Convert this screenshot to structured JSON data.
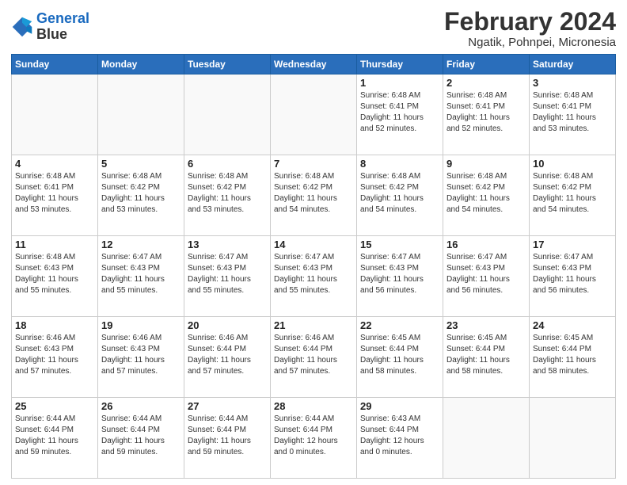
{
  "header": {
    "logo_line1": "General",
    "logo_line2": "Blue",
    "title": "February 2024",
    "subtitle": "Ngatik, Pohnpei, Micronesia"
  },
  "days_of_week": [
    "Sunday",
    "Monday",
    "Tuesday",
    "Wednesday",
    "Thursday",
    "Friday",
    "Saturday"
  ],
  "weeks": [
    [
      {
        "day": "",
        "info": ""
      },
      {
        "day": "",
        "info": ""
      },
      {
        "day": "",
        "info": ""
      },
      {
        "day": "",
        "info": ""
      },
      {
        "day": "1",
        "info": "Sunrise: 6:48 AM\nSunset: 6:41 PM\nDaylight: 11 hours\nand 52 minutes."
      },
      {
        "day": "2",
        "info": "Sunrise: 6:48 AM\nSunset: 6:41 PM\nDaylight: 11 hours\nand 52 minutes."
      },
      {
        "day": "3",
        "info": "Sunrise: 6:48 AM\nSunset: 6:41 PM\nDaylight: 11 hours\nand 53 minutes."
      }
    ],
    [
      {
        "day": "4",
        "info": "Sunrise: 6:48 AM\nSunset: 6:41 PM\nDaylight: 11 hours\nand 53 minutes."
      },
      {
        "day": "5",
        "info": "Sunrise: 6:48 AM\nSunset: 6:42 PM\nDaylight: 11 hours\nand 53 minutes."
      },
      {
        "day": "6",
        "info": "Sunrise: 6:48 AM\nSunset: 6:42 PM\nDaylight: 11 hours\nand 53 minutes."
      },
      {
        "day": "7",
        "info": "Sunrise: 6:48 AM\nSunset: 6:42 PM\nDaylight: 11 hours\nand 54 minutes."
      },
      {
        "day": "8",
        "info": "Sunrise: 6:48 AM\nSunset: 6:42 PM\nDaylight: 11 hours\nand 54 minutes."
      },
      {
        "day": "9",
        "info": "Sunrise: 6:48 AM\nSunset: 6:42 PM\nDaylight: 11 hours\nand 54 minutes."
      },
      {
        "day": "10",
        "info": "Sunrise: 6:48 AM\nSunset: 6:42 PM\nDaylight: 11 hours\nand 54 minutes."
      }
    ],
    [
      {
        "day": "11",
        "info": "Sunrise: 6:48 AM\nSunset: 6:43 PM\nDaylight: 11 hours\nand 55 minutes."
      },
      {
        "day": "12",
        "info": "Sunrise: 6:47 AM\nSunset: 6:43 PM\nDaylight: 11 hours\nand 55 minutes."
      },
      {
        "day": "13",
        "info": "Sunrise: 6:47 AM\nSunset: 6:43 PM\nDaylight: 11 hours\nand 55 minutes."
      },
      {
        "day": "14",
        "info": "Sunrise: 6:47 AM\nSunset: 6:43 PM\nDaylight: 11 hours\nand 55 minutes."
      },
      {
        "day": "15",
        "info": "Sunrise: 6:47 AM\nSunset: 6:43 PM\nDaylight: 11 hours\nand 56 minutes."
      },
      {
        "day": "16",
        "info": "Sunrise: 6:47 AM\nSunset: 6:43 PM\nDaylight: 11 hours\nand 56 minutes."
      },
      {
        "day": "17",
        "info": "Sunrise: 6:47 AM\nSunset: 6:43 PM\nDaylight: 11 hours\nand 56 minutes."
      }
    ],
    [
      {
        "day": "18",
        "info": "Sunrise: 6:46 AM\nSunset: 6:43 PM\nDaylight: 11 hours\nand 57 minutes."
      },
      {
        "day": "19",
        "info": "Sunrise: 6:46 AM\nSunset: 6:43 PM\nDaylight: 11 hours\nand 57 minutes."
      },
      {
        "day": "20",
        "info": "Sunrise: 6:46 AM\nSunset: 6:44 PM\nDaylight: 11 hours\nand 57 minutes."
      },
      {
        "day": "21",
        "info": "Sunrise: 6:46 AM\nSunset: 6:44 PM\nDaylight: 11 hours\nand 57 minutes."
      },
      {
        "day": "22",
        "info": "Sunrise: 6:45 AM\nSunset: 6:44 PM\nDaylight: 11 hours\nand 58 minutes."
      },
      {
        "day": "23",
        "info": "Sunrise: 6:45 AM\nSunset: 6:44 PM\nDaylight: 11 hours\nand 58 minutes."
      },
      {
        "day": "24",
        "info": "Sunrise: 6:45 AM\nSunset: 6:44 PM\nDaylight: 11 hours\nand 58 minutes."
      }
    ],
    [
      {
        "day": "25",
        "info": "Sunrise: 6:44 AM\nSunset: 6:44 PM\nDaylight: 11 hours\nand 59 minutes."
      },
      {
        "day": "26",
        "info": "Sunrise: 6:44 AM\nSunset: 6:44 PM\nDaylight: 11 hours\nand 59 minutes."
      },
      {
        "day": "27",
        "info": "Sunrise: 6:44 AM\nSunset: 6:44 PM\nDaylight: 11 hours\nand 59 minutes."
      },
      {
        "day": "28",
        "info": "Sunrise: 6:44 AM\nSunset: 6:44 PM\nDaylight: 12 hours\nand 0 minutes."
      },
      {
        "day": "29",
        "info": "Sunrise: 6:43 AM\nSunset: 6:44 PM\nDaylight: 12 hours\nand 0 minutes."
      },
      {
        "day": "",
        "info": ""
      },
      {
        "day": "",
        "info": ""
      }
    ]
  ]
}
